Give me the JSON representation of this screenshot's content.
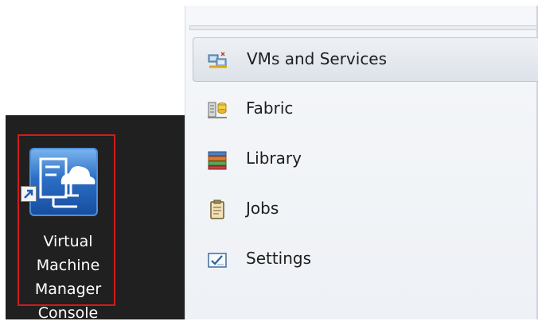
{
  "desktop": {
    "shortcut": {
      "label_lines": [
        "Virtual",
        "Machine",
        "Manager",
        "Console"
      ],
      "icon": "vmm-cloud-app-icon",
      "badge_icon": "shortcut-arrow-icon",
      "highlight_color": "#d01b1b"
    }
  },
  "navigation": {
    "items": [
      {
        "label": "VMs and Services",
        "icon": "vms-and-services-icon",
        "selected": true
      },
      {
        "label": "Fabric",
        "icon": "fabric-server-icon",
        "selected": false
      },
      {
        "label": "Library",
        "icon": "library-books-icon",
        "selected": false
      },
      {
        "label": "Jobs",
        "icon": "jobs-clipboard-icon",
        "selected": false
      },
      {
        "label": "Settings",
        "icon": "settings-checklist-icon",
        "selected": false
      }
    ]
  }
}
